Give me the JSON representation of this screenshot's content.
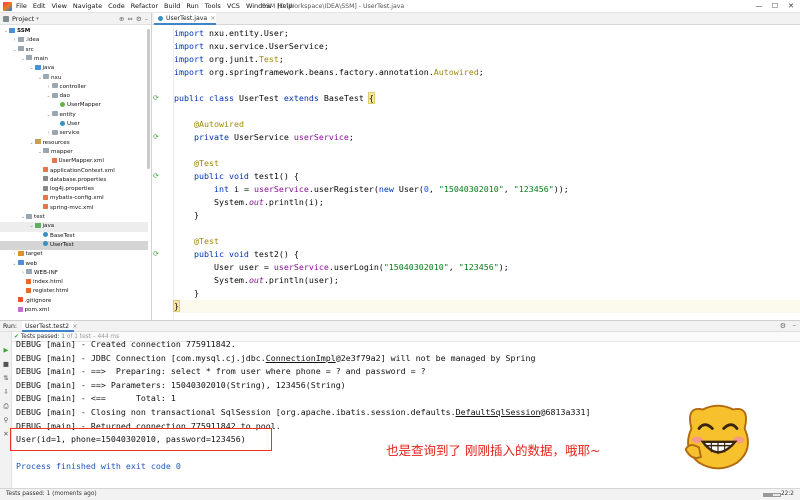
{
  "window": {
    "title": "SSM [D:\\Workspace\\IDEA\\SSM] - UserTest.java",
    "menu": [
      "File",
      "Edit",
      "View",
      "Navigate",
      "Code",
      "Refactor",
      "Build",
      "Run",
      "Tools",
      "VCS",
      "Window",
      "Help"
    ],
    "controls": [
      "—",
      "☐",
      "✕"
    ]
  },
  "project_panel": {
    "title": "Project",
    "tree": [
      {
        "label": "SSM",
        "depth": 0,
        "expanded": true,
        "icon": "module-folder-icon",
        "bold": true
      },
      {
        "label": ".idea",
        "depth": 1,
        "expanded": false,
        "icon": "folder-icon"
      },
      {
        "label": "src",
        "depth": 1,
        "expanded": true,
        "icon": "folder-icon"
      },
      {
        "label": "main",
        "depth": 2,
        "expanded": true,
        "icon": "folder-icon"
      },
      {
        "label": "java",
        "depth": 3,
        "expanded": true,
        "icon": "source-folder-icon"
      },
      {
        "label": "nxu",
        "depth": 4,
        "expanded": true,
        "icon": "package-icon"
      },
      {
        "label": "controller",
        "depth": 5,
        "expanded": false,
        "icon": "package-icon"
      },
      {
        "label": "dao",
        "depth": 5,
        "expanded": true,
        "icon": "package-icon"
      },
      {
        "label": "UserMapper",
        "depth": 6,
        "icon": "interface-icon"
      },
      {
        "label": "entity",
        "depth": 5,
        "expanded": true,
        "icon": "package-icon"
      },
      {
        "label": "User",
        "depth": 6,
        "icon": "class-icon"
      },
      {
        "label": "service",
        "depth": 5,
        "expanded": false,
        "icon": "package-icon"
      },
      {
        "label": "resources",
        "depth": 3,
        "expanded": true,
        "icon": "resources-folder-icon"
      },
      {
        "label": "mapper",
        "depth": 4,
        "expanded": true,
        "icon": "folder-icon"
      },
      {
        "label": "UserMapper.xml",
        "depth": 5,
        "icon": "xml-file-icon"
      },
      {
        "label": "applicationContext.xml",
        "depth": 4,
        "icon": "xml-file-icon"
      },
      {
        "label": "database.properties",
        "depth": 4,
        "icon": "properties-file-icon"
      },
      {
        "label": "log4j.properties",
        "depth": 4,
        "icon": "properties-file-icon"
      },
      {
        "label": "mybatis-config.xml",
        "depth": 4,
        "icon": "xml-file-icon"
      },
      {
        "label": "spring-mvc.xml",
        "depth": 4,
        "icon": "xml-file-icon"
      },
      {
        "label": "test",
        "depth": 2,
        "expanded": true,
        "icon": "folder-icon"
      },
      {
        "label": "java",
        "depth": 3,
        "expanded": true,
        "icon": "test-folder-icon",
        "state": "sel-dir"
      },
      {
        "label": "BaseTest",
        "depth": 4,
        "icon": "class-icon"
      },
      {
        "label": "UserTest",
        "depth": 4,
        "icon": "class-icon",
        "state": "selected"
      },
      {
        "label": "target",
        "depth": 1,
        "expanded": false,
        "icon": "excluded-folder-icon"
      },
      {
        "label": "web",
        "depth": 1,
        "expanded": true,
        "icon": "web-folder-icon"
      },
      {
        "label": "WEB-INF",
        "depth": 2,
        "expanded": false,
        "icon": "folder-icon"
      },
      {
        "label": "index.html",
        "depth": 2,
        "icon": "html-file-icon"
      },
      {
        "label": "register.html",
        "depth": 2,
        "icon": "html-file-icon"
      },
      {
        "label": ".gitignore",
        "depth": 1,
        "icon": "gitignore-file-icon"
      },
      {
        "label": "pom.xml",
        "depth": 1,
        "icon": "maven-file-icon"
      }
    ]
  },
  "editor": {
    "tab_label": "UserTest.java",
    "lines": [
      [
        {
          "t": "import",
          "c": "kw"
        },
        {
          "t": " nxu.entity.User;"
        }
      ],
      [
        {
          "t": "import",
          "c": "kw"
        },
        {
          "t": " nxu.service.UserService;"
        }
      ],
      [
        {
          "t": "import",
          "c": "kw"
        },
        {
          "t": " org.junit."
        },
        {
          "t": "Test",
          "c": "ann"
        },
        {
          "t": ";"
        }
      ],
      [
        {
          "t": "import",
          "c": "kw"
        },
        {
          "t": " org.springframework.beans.factory.annotation."
        },
        {
          "t": "Autowired",
          "c": "ann"
        },
        {
          "t": ";"
        }
      ],
      [],
      [
        {
          "t": "public class",
          "c": "kw"
        },
        {
          "t": " UserTest "
        },
        {
          "t": "extends",
          "c": "kw"
        },
        {
          "t": " BaseTest "
        },
        {
          "t": "{",
          "c": "brace-hl"
        }
      ],
      [],
      [
        {
          "t": "    "
        },
        {
          "t": "@Autowired",
          "c": "ann"
        }
      ],
      [
        {
          "t": "    "
        },
        {
          "t": "private",
          "c": "kw"
        },
        {
          "t": " UserService "
        },
        {
          "t": "userService",
          "c": "fld"
        },
        {
          "t": ";"
        }
      ],
      [],
      [
        {
          "t": "    "
        },
        {
          "t": "@Test",
          "c": "ann"
        }
      ],
      [
        {
          "t": "    "
        },
        {
          "t": "public void",
          "c": "kw"
        },
        {
          "t": " test1() {"
        }
      ],
      [
        {
          "t": "        "
        },
        {
          "t": "int",
          "c": "kw"
        },
        {
          "t": " i = "
        },
        {
          "t": "userService",
          "c": "fld"
        },
        {
          "t": ".userRegister("
        },
        {
          "t": "new",
          "c": "kw"
        },
        {
          "t": " User("
        },
        {
          "t": "0",
          "c": "num"
        },
        {
          "t": ", "
        },
        {
          "t": "\"15040302010\"",
          "c": "str"
        },
        {
          "t": ", "
        },
        {
          "t": "\"123456\"",
          "c": "str"
        },
        {
          "t": "));"
        }
      ],
      [
        {
          "t": "        System."
        },
        {
          "t": "out",
          "c": "stat"
        },
        {
          "t": ".println(i);"
        }
      ],
      [
        {
          "t": "    }"
        }
      ],
      [],
      [
        {
          "t": "    "
        },
        {
          "t": "@Test",
          "c": "ann"
        }
      ],
      [
        {
          "t": "    "
        },
        {
          "t": "public void",
          "c": "kw"
        },
        {
          "t": " test2() {"
        }
      ],
      [
        {
          "t": "        User user = "
        },
        {
          "t": "userService",
          "c": "fld"
        },
        {
          "t": ".userLogin("
        },
        {
          "t": "\"15040302010\"",
          "c": "str"
        },
        {
          "t": ", "
        },
        {
          "t": "\"123456\"",
          "c": "str"
        },
        {
          "t": ");"
        }
      ],
      [
        {
          "t": "        System."
        },
        {
          "t": "out",
          "c": "stat"
        },
        {
          "t": ".println(user);"
        }
      ],
      [
        {
          "t": "    }"
        }
      ],
      [
        {
          "t": "}",
          "c": "brace-hl"
        }
      ]
    ]
  },
  "run_panel": {
    "label": "Run:",
    "tab_label": "UserTest.test2",
    "tests_passed_prefix": "Tests passed: ",
    "tests_passed_count": "1",
    "tests_passed_suffix": " of 1 test – 444 ms",
    "console_lines": [
      [
        {
          "t": "DEBUG [main] - Created connection 775911842."
        }
      ],
      [
        {
          "t": "DEBUG [main] - JDBC Connection [com.mysql.cj.jdbc."
        },
        {
          "t": "ConnectionImpl",
          "c": "uline"
        },
        {
          "t": "@2e3f79a2] will not be managed by Spring"
        }
      ],
      [
        {
          "t": "DEBUG [main] - ==>  Preparing: select * from user where phone = ? and password = ?"
        }
      ],
      [
        {
          "t": "DEBUG [main] - ==> Parameters: 15040302010(String), 123456(String)"
        }
      ],
      [
        {
          "t": "DEBUG [main] - <==      Total: 1"
        }
      ],
      [
        {
          "t": "DEBUG [main] - Closing non transactional SqlSession [org.apache.ibatis.session.defaults."
        },
        {
          "t": "DefaultSqlSession",
          "c": "uline"
        },
        {
          "t": "@6813a331]"
        }
      ],
      [
        {
          "t": "DEBUG [main] - Returned connection 775911842 to pool."
        }
      ],
      [
        {
          "t": "User(id=1, phone=15040302010, password=123456)"
        }
      ],
      [],
      [
        {
          "t": "Process finished with exit code 0",
          "c": "exit"
        }
      ]
    ],
    "annotation": "也是查询到了 刚刚插入的数据，哦耶~",
    "sticker": "grinning-face-sticker"
  },
  "status_bar": {
    "text": "Tests passed: 1 (moments ago)",
    "position": "22:2"
  },
  "colors": {
    "accent": "#4083c9",
    "keyword": "#0033b3",
    "annotation": "#9e880d",
    "field": "#871094",
    "string": "#067d17",
    "highlight_box": "#e32222",
    "annotation_text": "#e2241b"
  }
}
